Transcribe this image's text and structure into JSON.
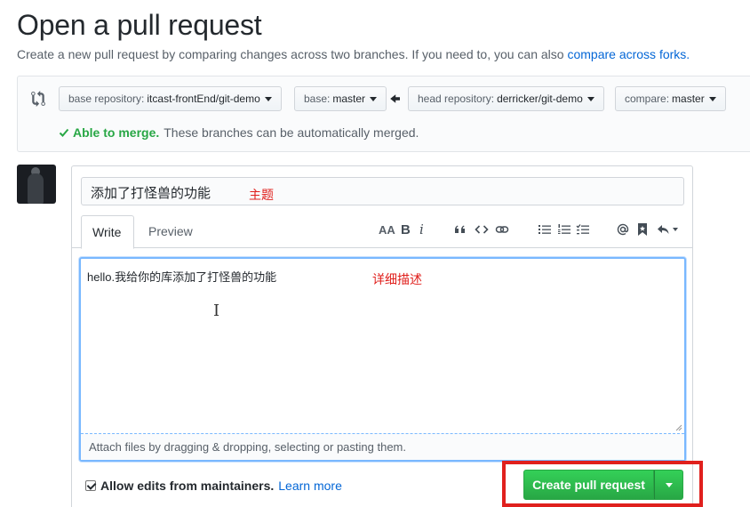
{
  "header": {
    "title": "Open a pull request",
    "subtitle": "Create a new pull request by comparing changes across two branches. If you need to, you can also",
    "compare_forks_link": "compare across forks."
  },
  "range": {
    "base_repo_label": "base repository:",
    "base_repo_value": "itcast-frontEnd/git-demo",
    "base_label": "base:",
    "base_value": "master",
    "head_repo_label": "head repository:",
    "head_repo_value": "derricker/git-demo",
    "compare_label": "compare:",
    "compare_value": "master",
    "merge_ok": "Able to merge.",
    "merge_message": "These branches can be automatically merged."
  },
  "form": {
    "title_value": "添加了打怪兽的功能",
    "title_annotation": "主题",
    "tabs": [
      "Write",
      "Preview"
    ],
    "toolbar": {
      "header": "AA",
      "bold": "B",
      "italic": "i"
    },
    "body_value": "hello.我给你的库添加了打怪兽的功能",
    "body_annotation": "详细描述",
    "attach_hint": "Attach files by dragging & dropping, selecting or pasting them."
  },
  "footer": {
    "allow_edits_label": "Allow edits from maintainers.",
    "allow_edits_checked": true,
    "learn_more": "Learn more",
    "create_button": "Create pull request"
  },
  "colors": {
    "link": "#0366d6",
    "success": "#28a745",
    "annotation": "#e0201d"
  }
}
